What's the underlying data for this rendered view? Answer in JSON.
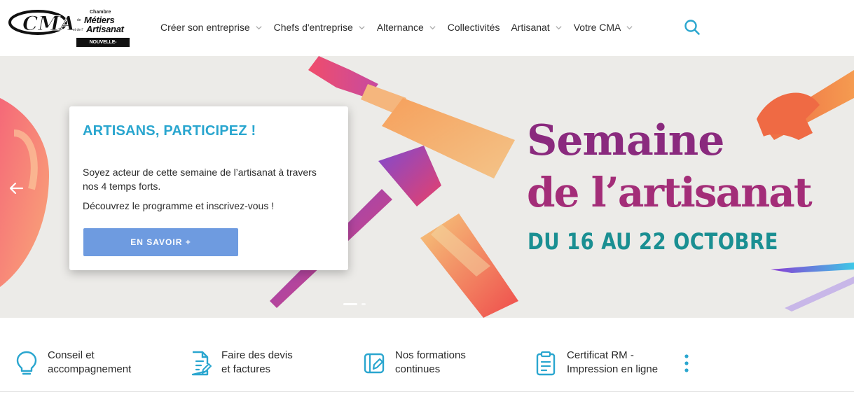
{
  "header": {
    "logo": {
      "mark": "CMA",
      "line1": "Chambre",
      "line2_small": "de",
      "line2": "Métiers",
      "line3_small": "et de l'",
      "line3": "Artisanat",
      "badge": "NOUVELLE-CALÉDONIE"
    },
    "nav": [
      {
        "label": "Créer son entreprise",
        "has_dropdown": true
      },
      {
        "label": "Chefs d'entreprise",
        "has_dropdown": true
      },
      {
        "label": "Alternance",
        "has_dropdown": true
      },
      {
        "label": "Collectivités",
        "has_dropdown": false
      },
      {
        "label": "Artisanat",
        "has_dropdown": true
      },
      {
        "label": "Votre CMA",
        "has_dropdown": true
      }
    ],
    "search_icon": "search-icon"
  },
  "hero": {
    "card": {
      "title": "ARTISANS, PARTICIPEZ !",
      "text1": "Soyez acteur de cette semaine de l’artisanat à travers nos 4 temps forts.",
      "text2": "Découvrez le programme et inscrivez-vous !",
      "button": "EN SAVOIR +"
    },
    "banner": {
      "title_line1": "Semaine",
      "title_line2": "de l’artisanat",
      "dates": "DU 16 AU 22 OCTOBRE"
    },
    "slides_count": 2,
    "active_slide": 1
  },
  "quicklinks": [
    {
      "line1": "Conseil et",
      "line2": "accompagnement",
      "icon": "lightbulb-icon"
    },
    {
      "line1": "Faire des devis",
      "line2": "et factures",
      "icon": "document-edit-icon"
    },
    {
      "line1": "Nos formations",
      "line2": "continues",
      "icon": "book-pencil-icon"
    },
    {
      "line1": "Certificat RM -",
      "line2": "Impression en ligne",
      "icon": "clipboard-icon"
    }
  ],
  "colors": {
    "accent": "#2aa6cf",
    "button": "#6e9be0",
    "title_purple": "#8a2a7e",
    "dates_teal": "#1a8f92"
  }
}
